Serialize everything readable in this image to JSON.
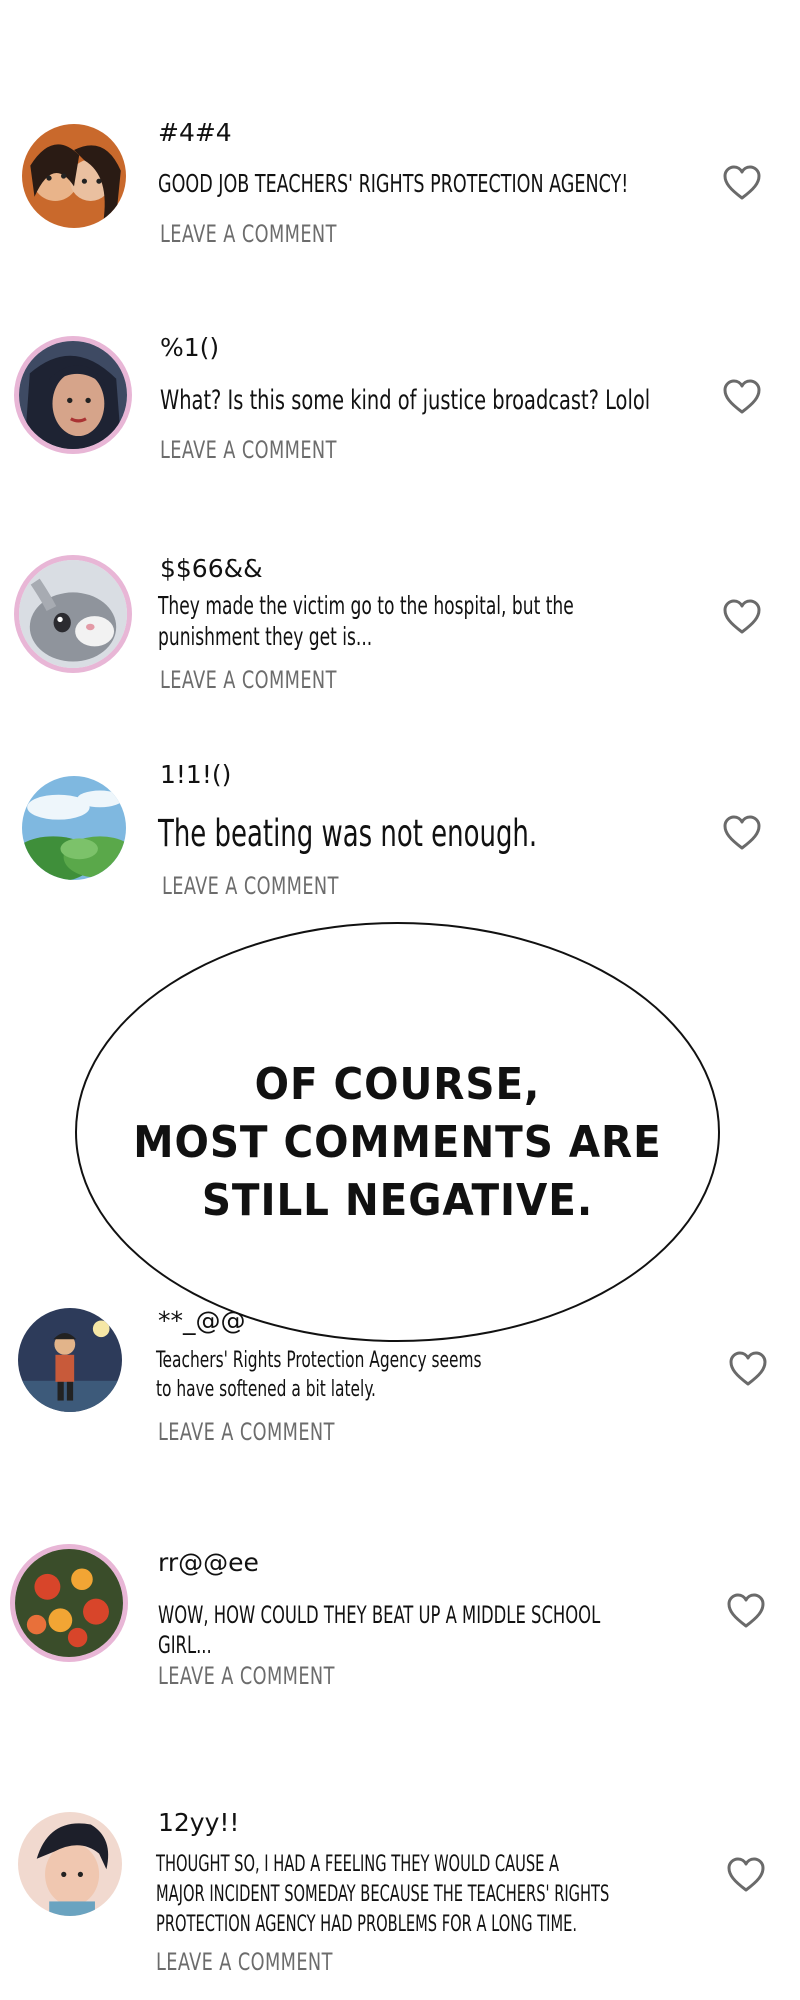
{
  "comments": [
    {
      "username": "#4#4",
      "text": "GOOD JOB TEACHERS' RIGHTS PROTECTION AGENCY!",
      "reply_label": "LEAVE A COMMENT",
      "avatar_icon": "avatar-two-girls-icon",
      "like_icon": "heart-icon"
    },
    {
      "username": "%1()",
      "text": "What? Is this some kind of justice broadcast? Lolol",
      "reply_label": "LEAVE A COMMENT",
      "avatar_icon": "avatar-woman-portrait-icon",
      "like_icon": "heart-icon"
    },
    {
      "username": "$$66&&",
      "text": "They made the victim go to the hospital, but the\npunishment they get is...",
      "reply_label": "LEAVE A COMMENT",
      "avatar_icon": "avatar-bunny-icon",
      "like_icon": "heart-icon"
    },
    {
      "username": "1!1!()",
      "text": "The beating was not enough.",
      "reply_label": "LEAVE A COMMENT",
      "avatar_icon": "avatar-sky-landscape-icon",
      "like_icon": "heart-icon"
    },
    {
      "username": "**_@@",
      "text": "Teachers' Rights Protection Agency seems\nto have softened a bit lately.",
      "reply_label": "LEAVE A COMMENT",
      "avatar_icon": "avatar-boy-night-icon",
      "like_icon": "heart-icon"
    },
    {
      "username": "rr@@ee",
      "text": "WOW, HOW COULD THEY BEAT UP A MIDDLE SCHOOL GIRL...",
      "reply_label": "LEAVE A COMMENT",
      "avatar_icon": "avatar-flowers-icon",
      "like_icon": "heart-icon"
    },
    {
      "username": "12yy!!",
      "text": "THOUGHT SO, I HAD A FEELING THEY WOULD CAUSE A\nMAJOR INCIDENT SOMEDAY BECAUSE THE TEACHERS' RIGHTS\nPROTECTION AGENCY HAD PROBLEMS FOR A LONG TIME.",
      "reply_label": "LEAVE A COMMENT",
      "avatar_icon": "avatar-dark-hair-boy-icon",
      "like_icon": "heart-icon"
    }
  ],
  "speech_bubble": {
    "text": "OF COURSE,\nMOST COMMENTS ARE\nSTILL NEGATIVE."
  },
  "colors": {
    "text": "#111111",
    "reply": "#6c6c6c",
    "heart_stroke": "#6a6a6a",
    "ring": "#e8b6d6"
  }
}
